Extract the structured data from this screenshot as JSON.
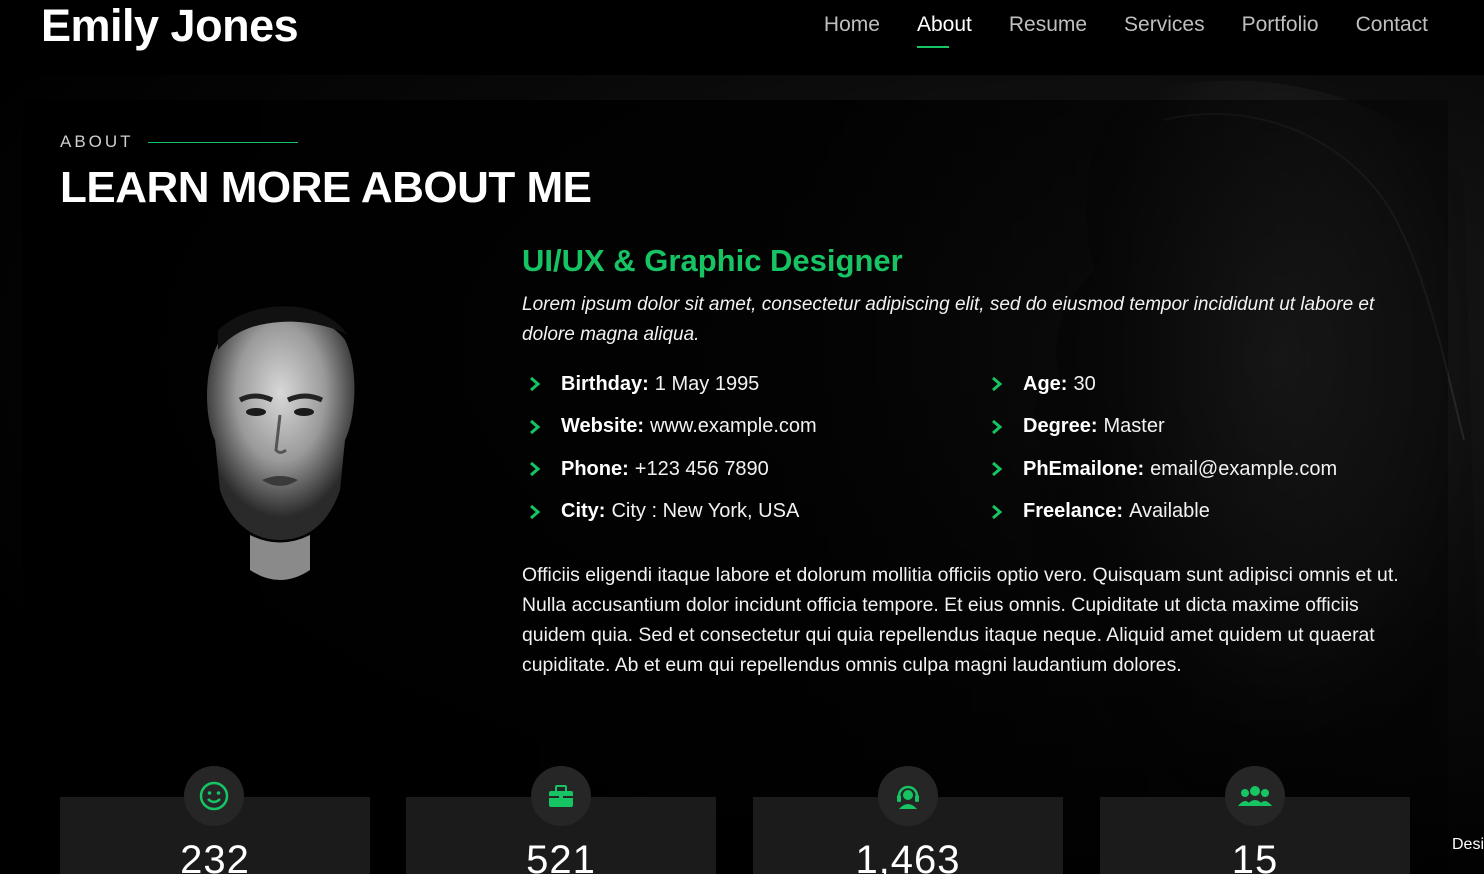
{
  "header": {
    "logo": "Emily Jones",
    "nav": [
      "Home",
      "About",
      "Resume",
      "Services",
      "Portfolio",
      "Contact"
    ],
    "active_nav": "About"
  },
  "about": {
    "eyebrow": "ABOUT",
    "title": "LEARN MORE ABOUT ME",
    "role": "UI/UX & Graphic Designer",
    "lead": "Lorem ipsum dolor sit amet, consectetur adipiscing elit, sed do eiusmod tempor incididunt ut labore et dolore magna aliqua.",
    "facts_left": [
      {
        "label": "Birthday:",
        "value": "1 May 1995"
      },
      {
        "label": "Website:",
        "value": "www.example.com"
      },
      {
        "label": "Phone:",
        "value": "+123 456 7890"
      },
      {
        "label": "City:",
        "value": "City : New York, USA"
      }
    ],
    "facts_right": [
      {
        "label": "Age:",
        "value": "30"
      },
      {
        "label": "Degree:",
        "value": "Master"
      },
      {
        "label": "PhEmailone:",
        "value": "email@example.com"
      },
      {
        "label": "Freelance:",
        "value": "Available"
      }
    ],
    "body": "Officiis eligendi itaque labore et dolorum mollitia officiis optio vero. Quisquam sunt adipisci omnis et ut. Nulla accusantium dolor incidunt officia tempore. Et eius omnis. Cupiditate ut dicta maxime officiis quidem quia. Sed et consectetur qui quia repellendus itaque neque. Aliquid amet quidem ut quaerat cupiditate. Ab et eum qui repellendus omnis culpa magni laudantium dolores."
  },
  "stats": [
    {
      "icon": "smiley-icon",
      "value": "232"
    },
    {
      "icon": "briefcase-icon",
      "value": "521"
    },
    {
      "icon": "headset-icon",
      "value": "1,463"
    },
    {
      "icon": "people-icon",
      "value": "15"
    }
  ],
  "corner_note": "Desi",
  "colors": {
    "accent": "#16c464",
    "background": "#000000",
    "card": "#1b1b1b"
  }
}
